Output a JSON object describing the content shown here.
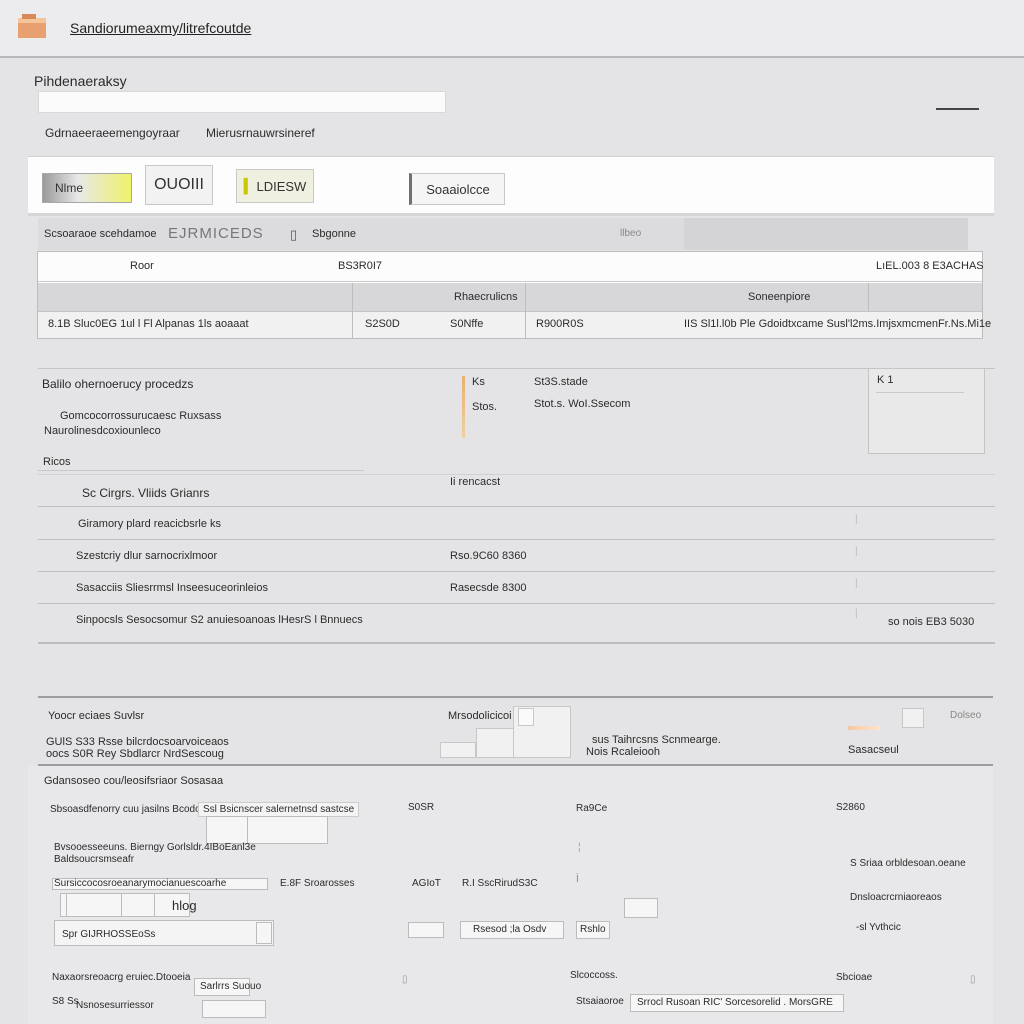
{
  "window": {
    "title": "Sandiorumeaxmy/litrefcoutde"
  },
  "header": {
    "section_label": "Pihdenaeraksy",
    "input_value": "",
    "subtitle_left": "Gdrnaeeraeemengoyraar",
    "subtitle_right": "Mierusrnauwrsineref"
  },
  "toolbar": {
    "btn1_label": "Nlme",
    "btn2_label": "OUOIII",
    "btn3_label": "LDIESW",
    "btn4_label": "Soaaiolcce"
  },
  "filterbar": {
    "label": "Scsoaraoe scehdamoe",
    "field_value": "EJRMICEDS",
    "field2_label": "Sbgonne",
    "status": "llbeo"
  },
  "table": {
    "row1": {
      "col1": "Roor",
      "col2": "BS3R0I7",
      "col3": "LıEL.003 8 E3ACHAS"
    },
    "row2": {
      "col2": "Rhaecrulicns",
      "col3": "Soneenpiore"
    },
    "row3": {
      "c1": "8.1B Sluc0EG 1ul l Fl Alpanas 1ls aoaaat",
      "c2": "S2S0D",
      "c3": "S0Nffe",
      "c4": "R900R0S",
      "c5": "IIS Sl1l.l0b Ple Gdoidtxcame Susl'l2ms.ImjsxmcmenFr.Ns.Mi1e"
    }
  },
  "details": {
    "title": "Balilo ohernoerucy procedzs",
    "line1": "Gomcocorrossurucaesc Ruxsass",
    "line2": "Naurolinesdcoxiounleco",
    "section_heading": "Ricos",
    "mid_k1": "Ks",
    "mid_v1": "St3S.stade",
    "mid_k2": "Stos.",
    "mid_v2": "Stot.s. WoI.Ssecom",
    "side_value": "K 1",
    "mid_label": "Ii rencacst",
    "rows": [
      {
        "label": "Sc Cirgrs. Vliids Grianrs",
        "value": "",
        "extra": ""
      },
      {
        "label": "Giramory plard reacicbsrle ks",
        "value": "",
        "extra": ""
      },
      {
        "label": "Szestcriy dlur sarnocrixlmoor",
        "value": "Rso.9C60 8360",
        "extra": ""
      },
      {
        "label": "Sasacciis Sliesrrmsl Inseesuceorinleios",
        "value": "Rasecsde 8300",
        "extra": ""
      },
      {
        "label": "Sinpocsls Sesocsomur S2 anuiesoanoas lHesrS l Bnnuecs",
        "value": "",
        "extra": "so nois EB3 5030"
      }
    ]
  },
  "section3": {
    "title": "Yoocr eciaes Suvlsr",
    "line1": "GUlS S33 Rsse bilcrdocsoarvoiceaos",
    "line2": "oocs S0R Rey Sbdlarcr NrdSescoug",
    "mid_label": "Mrsodolicicoi",
    "right1": "sus Taihrcsns Scnmearge.",
    "right2": "Nois Rcaleiooh",
    "far_label": "Sasacseul",
    "far_top": "Dolseo"
  },
  "footer": {
    "title": "Gdansoseo cou/leosifsriaor Sosasaa",
    "r1_a": "Sbsoasdfenorry cuu jasilns Bcodo",
    "r1_b": "Ssl Bsicnscer salernetnsd sastcse",
    "r1_c": "S0SR",
    "r1_d": "Ra9Ce",
    "r1_e": "S2860",
    "r2_a": "Bvsooesseeuns. Bierngy Gorlsldr.4IBoEanl3e",
    "r2_b": "Baldsoucrsmseafr",
    "r2_c": "S  Sriaa orbldesoan.oeane",
    "r3_a": "Sursiccocosroeanarymocianuescoarhe",
    "r3_b": "E.8F Sroarosses",
    "r3_c": "AGIoT",
    "r3_d": "R.I SscRirudS3C",
    "r3_e": "Dnsloacrcrniaoreaos",
    "r4_a": "hlog",
    "r5_a": "Spr GIJRHOSSEoSs",
    "r5_b": "Rsesod  ;la  Osdv",
    "r5_c": "Rshlo",
    "r5_d": "-sl Yvthcic",
    "r6_a": "Naxaorsreoacrg eruiec.Dtooeia",
    "r6_b": "Sarlrrs Suouo",
    "r6_c": "Slcoccoss.",
    "r6_d": "Sbcioae",
    "r7_a": "S8 Ss",
    "r7_b": "Nsnosesurriessor",
    "r7_c": "Stsaiaoroe",
    "r7_d": "Srrocl     Rusoan RIC'  Sorcesorelid .  MorsGRE"
  }
}
